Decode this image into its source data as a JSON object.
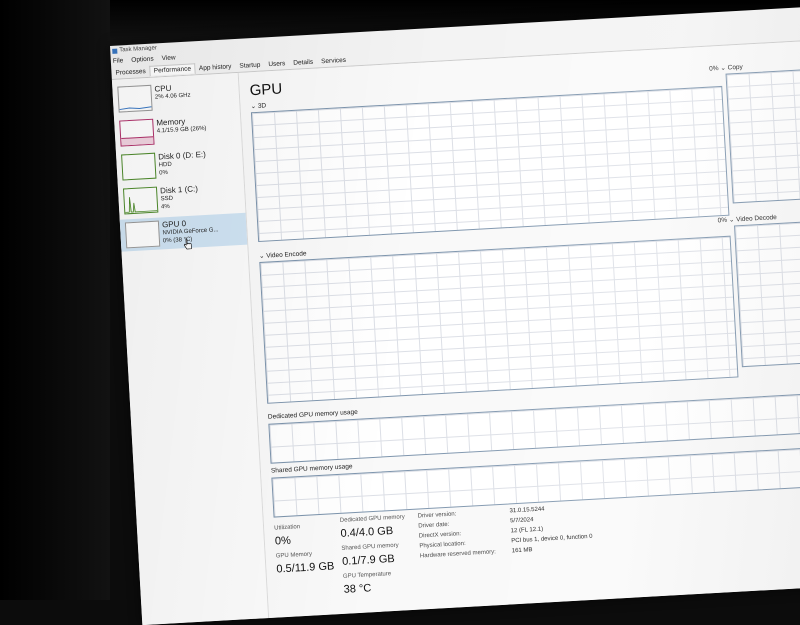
{
  "window": {
    "title": "Task Manager"
  },
  "menu": [
    "File",
    "Options",
    "View"
  ],
  "tabs": [
    "Processes",
    "Performance",
    "App history",
    "Startup",
    "Users",
    "Details",
    "Services"
  ],
  "sidebar": {
    "items": [
      {
        "title": "CPU",
        "line1": "2% 4.06 GHz",
        "line2": ""
      },
      {
        "title": "Memory",
        "line1": "4.1/15.9 GB (26%)",
        "line2": ""
      },
      {
        "title": "Disk 0 (D: E:)",
        "line1": "HDD",
        "line2": "0%"
      },
      {
        "title": "Disk 1 (C:)",
        "line1": "SSD",
        "line2": "4%"
      },
      {
        "title": "GPU 0",
        "line1": "NVIDIA GeForce G...",
        "line2": "0% (38 °C)"
      }
    ]
  },
  "main": {
    "title": "GPU",
    "graphs": {
      "g3d": {
        "label": "3D",
        "percent": ""
      },
      "copy": {
        "label": "Copy",
        "percent": "0%"
      },
      "encode": {
        "label": "Video Encode",
        "percent": ""
      },
      "decode": {
        "label": "Video Decode",
        "percent": "0%"
      },
      "dedicated": {
        "label": "Dedicated GPU memory usage"
      },
      "shared": {
        "label": "Shared GPU memory usage"
      }
    },
    "stats": {
      "utilization": {
        "label": "Utilization",
        "value": "0%"
      },
      "dedicated": {
        "label": "Dedicated GPU memory",
        "value": "0.4/4.0 GB"
      },
      "gpu_memory": {
        "label": "GPU Memory",
        "value": "0.5/11.9 GB"
      },
      "shared": {
        "label": "Shared GPU memory",
        "value": "0.1/7.9 GB"
      },
      "temperature": {
        "label": "GPU Temperature",
        "value": "38 °C"
      }
    },
    "properties": [
      {
        "label": "Driver version:",
        "value": "31.0.15.5244"
      },
      {
        "label": "Driver date:",
        "value": "5/7/2024"
      },
      {
        "label": "DirectX version:",
        "value": "12 (FL 12.1)"
      },
      {
        "label": "Physical location:",
        "value": "PCI bus 1, device 0, function 0"
      },
      {
        "label": "Hardware reserved memory:",
        "value": "161 MB"
      }
    ]
  },
  "colors": {
    "selected": "#cfe3f3",
    "graph_border": "#7e95ad",
    "memory_accent": "#b0306a",
    "disk_accent": "#4d8a2a",
    "cpu_accent": "#3a78c4"
  },
  "icons": [
    "task-manager-icon",
    "chevron-down-icon",
    "hand-pointer-icon"
  ]
}
